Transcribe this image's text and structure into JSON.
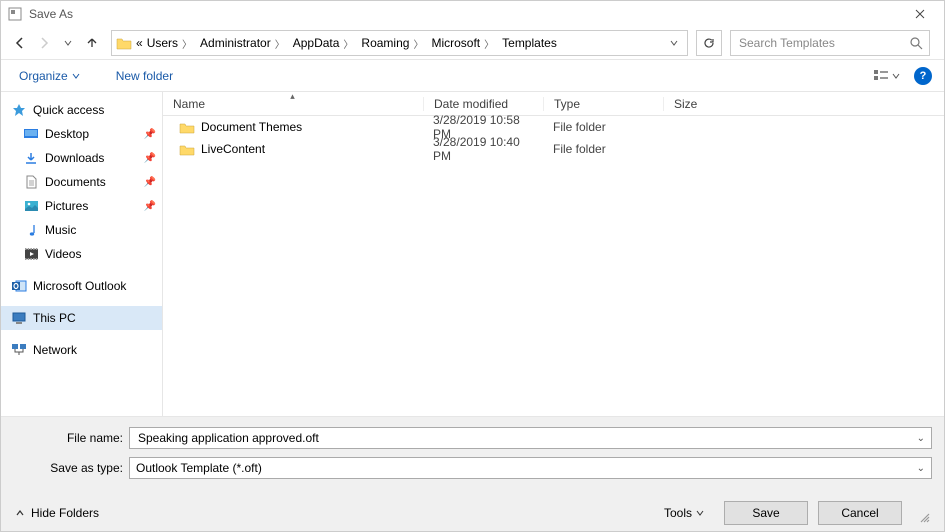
{
  "title": "Save As",
  "breadcrumbs": [
    "Users",
    "Administrator",
    "AppData",
    "Roaming",
    "Microsoft",
    "Templates"
  ],
  "breadcrumbs_prefix": "«",
  "search_placeholder": "Search Templates",
  "cmd": {
    "organize": "Organize",
    "newfolder": "New folder"
  },
  "columns": {
    "name": "Name",
    "date": "Date modified",
    "type": "Type",
    "size": "Size"
  },
  "files": [
    {
      "name": "Document Themes",
      "date": "3/28/2019 10:58 PM",
      "type": "File folder",
      "size": ""
    },
    {
      "name": "LiveContent",
      "date": "3/28/2019 10:40 PM",
      "type": "File folder",
      "size": ""
    }
  ],
  "sidebar": {
    "quick": "Quick access",
    "desktop": "Desktop",
    "downloads": "Downloads",
    "documents": "Documents",
    "pictures": "Pictures",
    "music": "Music",
    "videos": "Videos",
    "outlook": "Microsoft Outlook",
    "thispc": "This PC",
    "network": "Network"
  },
  "form": {
    "filename_label": "File name:",
    "filename_value": "Speaking application approved.oft",
    "savetype_label": "Save as type:",
    "savetype_value": "Outlook Template (*.oft)"
  },
  "buttons": {
    "tools": "Tools",
    "save": "Save",
    "cancel": "Cancel",
    "hide": "Hide Folders"
  }
}
